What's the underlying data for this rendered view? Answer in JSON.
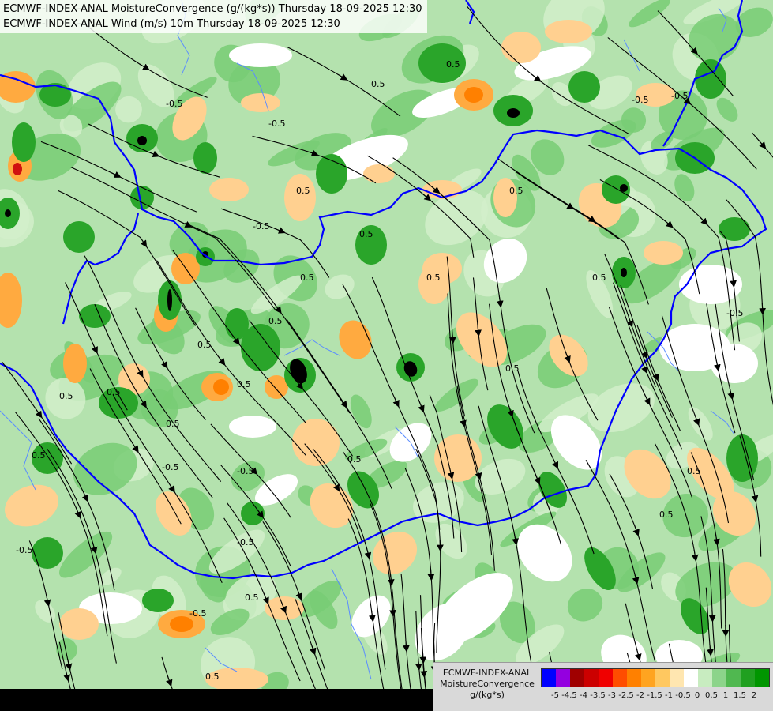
{
  "title": {
    "line1": "ECMWF-INDEX-ANAL MoistureConvergence (g/(kg*s)) Thursday 18-09-2025 12:30",
    "line2": "ECMWF-INDEX-ANAL Wind (m/s) 10m Thursday 18-09-2025 12:30"
  },
  "legend": {
    "name_line1": "ECMWF-INDEX-ANAL",
    "name_line2": "MoistureConvergence",
    "unit": "g/(kg*s)",
    "colors": [
      "#0000ff",
      "#9400e0",
      "#a00000",
      "#cc0000",
      "#f00000",
      "#ff4d00",
      "#ff8000",
      "#ffa420",
      "#ffc860",
      "#ffe6b0",
      "#ffffff",
      "#c8ecc0",
      "#8cd48a",
      "#50b850",
      "#20a020",
      "#009600"
    ],
    "ticks": [
      "-5",
      "-4.5",
      "-4",
      "-3.5",
      "-3",
      "-2.5",
      "-2",
      "-1.5",
      "-1",
      "-0.5",
      "0",
      "0.5",
      "1",
      "1.5",
      "2"
    ]
  },
  "contour_labels": [
    "-0.5",
    "0.5",
    "-0.5",
    "0.5",
    "0.5",
    "-0.5",
    "0.5",
    "0.5",
    "0.5",
    "-0.5",
    "0.5",
    "0.5",
    "0.5",
    "0.5",
    "-0.5",
    "-0.5",
    "0.5",
    "0.5",
    "0.5",
    "0.5",
    "-0.5",
    "0.5",
    "-0.5",
    "0.5",
    "0.5",
    "0.5",
    "-0.5",
    "0.5",
    "0.5",
    "-0.5",
    "0.5",
    "-0.5"
  ],
  "colors": {
    "background_green": "#8cd48a",
    "border_blue": "#0000ff",
    "river_blue": "#5a8cff",
    "streamline": "#000000"
  }
}
